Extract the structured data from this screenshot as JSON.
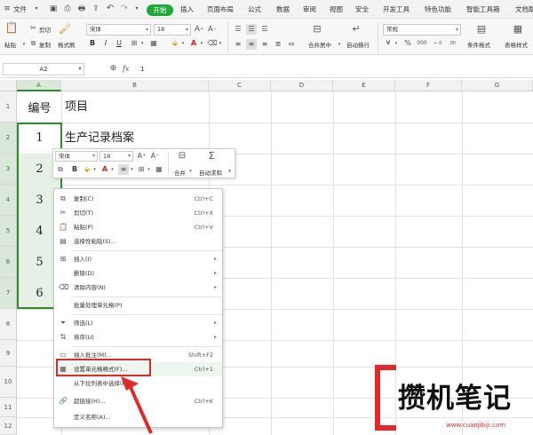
{
  "ribbon": {
    "tabs": [
      {
        "label": "文件"
      },
      {
        "label": "开始"
      },
      {
        "label": "插入"
      },
      {
        "label": "页面布局"
      },
      {
        "label": "公式"
      },
      {
        "label": "数据"
      },
      {
        "label": "审阅"
      },
      {
        "label": "视图"
      },
      {
        "label": "安全"
      },
      {
        "label": "开发工具"
      },
      {
        "label": "特色功能"
      },
      {
        "label": "智能工具箱"
      },
      {
        "label": "文档助"
      }
    ],
    "active_tab_color": "#1fa83a",
    "paste_label": "粘贴",
    "cut_label": "剪切",
    "copy_label": "复制",
    "format_painter_label": "格式刷",
    "font_name": "宋体",
    "font_size": "18",
    "merge_label": "合并居中",
    "wrap_label": "自动换行",
    "number_format": "常规",
    "cond_format_label": "条件格式",
    "table_style_label": "表格样式"
  },
  "formula_bar": {
    "name_box": "A2",
    "fx_label": "fx",
    "value": "1"
  },
  "sheet": {
    "columns": [
      "A",
      "B",
      "C",
      "D",
      "E",
      "F",
      "G"
    ],
    "rows": [
      "1",
      "2",
      "3",
      "4",
      "5",
      "6",
      "7",
      "8",
      "9",
      "10",
      "11",
      "12"
    ],
    "header_a": "编号",
    "header_b": "项目",
    "b2": "生产记录档案",
    "a_values": [
      "1",
      "2",
      "3",
      "4",
      "5",
      "6"
    ]
  },
  "mini_toolbar": {
    "font_name": "宋体",
    "font_size": "18",
    "merge_label": "合并",
    "autosum_label": "自动求和"
  },
  "context_menu": {
    "items": [
      {
        "label": "复制(C)",
        "shortcut": "Ctrl+C",
        "icon": "copy-icon"
      },
      {
        "label": "剪切(T)",
        "shortcut": "Ctrl+X",
        "icon": "scissors-icon"
      },
      {
        "label": "粘贴(P)",
        "shortcut": "Ctrl+V",
        "icon": "paste-icon"
      },
      {
        "label": "选择性粘贴(S)...",
        "shortcut": "",
        "icon": "paste-special-icon"
      },
      {
        "label": "插入(I)",
        "shortcut": "",
        "icon": "insert-icon"
      },
      {
        "label": "删除(D)",
        "shortcut": "",
        "icon": ""
      },
      {
        "label": "清除内容(N)",
        "shortcut": "",
        "icon": "eraser-icon"
      },
      {
        "label": "批量处理单元格(P)",
        "shortcut": "",
        "icon": ""
      },
      {
        "label": "筛选(L)",
        "shortcut": "",
        "icon": "filter-icon"
      },
      {
        "label": "排序(U)",
        "shortcut": "",
        "icon": "sort-icon"
      },
      {
        "label": "插入批注(M)...",
        "shortcut": "Shift+F2",
        "icon": "comment-icon"
      },
      {
        "label": "设置单元格格式(F)...",
        "shortcut": "Ctrl+1",
        "icon": "format-cells-icon"
      },
      {
        "label": "从下拉列表中选择(K)...",
        "shortcut": "",
        "icon": ""
      },
      {
        "label": "超链接(H)...",
        "shortcut": "Ctrl+K",
        "icon": "link-icon"
      },
      {
        "label": "定义名称(A)...",
        "shortcut": "",
        "icon": ""
      }
    ],
    "highlight_color": "#e02a2a"
  },
  "watermark": {
    "title": "攒机笔记",
    "url": "www.cuanjibiji.com"
  }
}
